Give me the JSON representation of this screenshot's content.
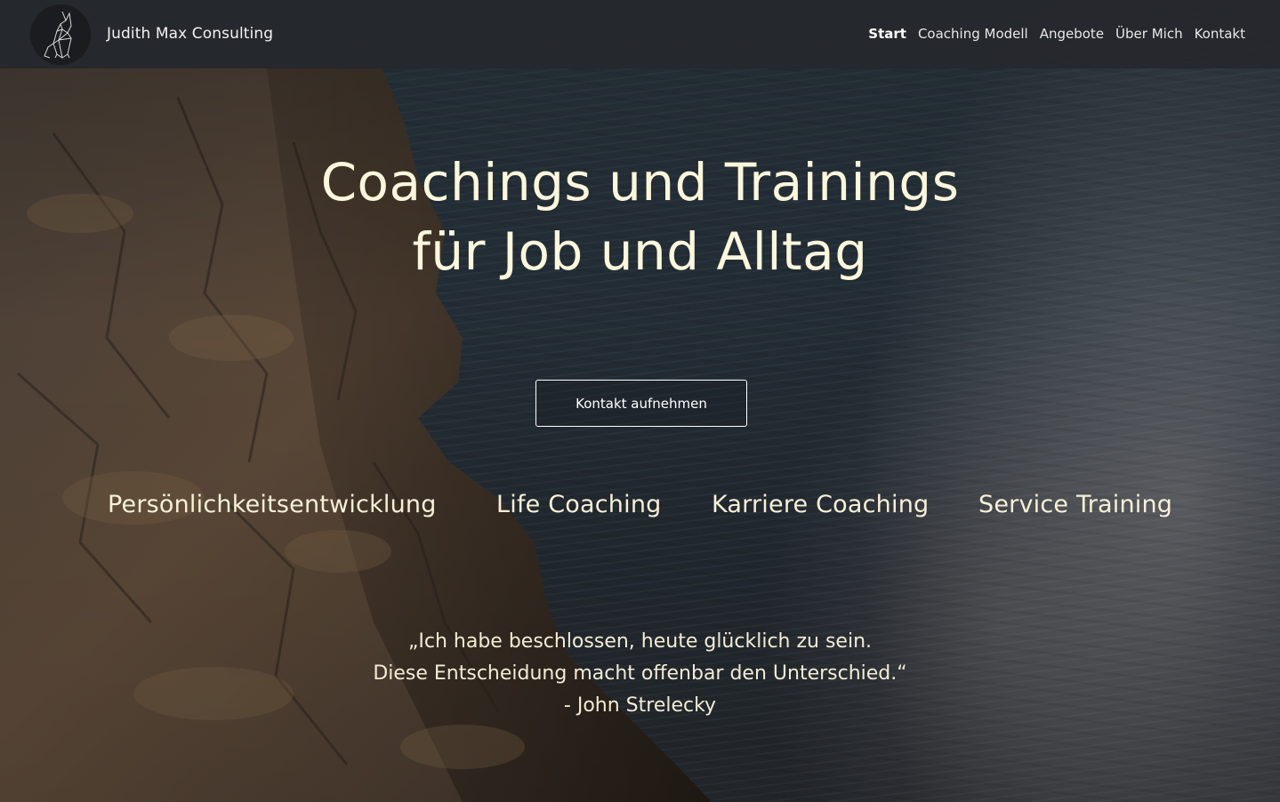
{
  "brand": {
    "name": "Judith Max Consulting",
    "logo_icon": "wolf-icon"
  },
  "nav": {
    "items": [
      {
        "label": "Start",
        "active": true
      },
      {
        "label": "Coaching Modell",
        "active": false
      },
      {
        "label": "Angebote",
        "active": false
      },
      {
        "label": "Über Mich",
        "active": false
      },
      {
        "label": "Kontakt",
        "active": false
      }
    ]
  },
  "hero": {
    "title_line1": "Coachings und Trainings",
    "title_line2": "für Job und Alltag",
    "cta_label": "Kontakt aufnehmen",
    "services": [
      "Persönlichkeitsentwicklung",
      "Life Coaching",
      "Karriere Coaching",
      "Service Training"
    ],
    "quote_line1": "„Ich habe beschlossen, heute glücklich zu sein.",
    "quote_line2": "Diese Entscheidung macht offenbar den Unterschied.“",
    "quote_author": "- John Strelecky"
  },
  "colors": {
    "navbar_bg": "#26282c",
    "title_text": "#fbf6dc",
    "water": "#232a31",
    "rock": "#5a4a3a"
  }
}
